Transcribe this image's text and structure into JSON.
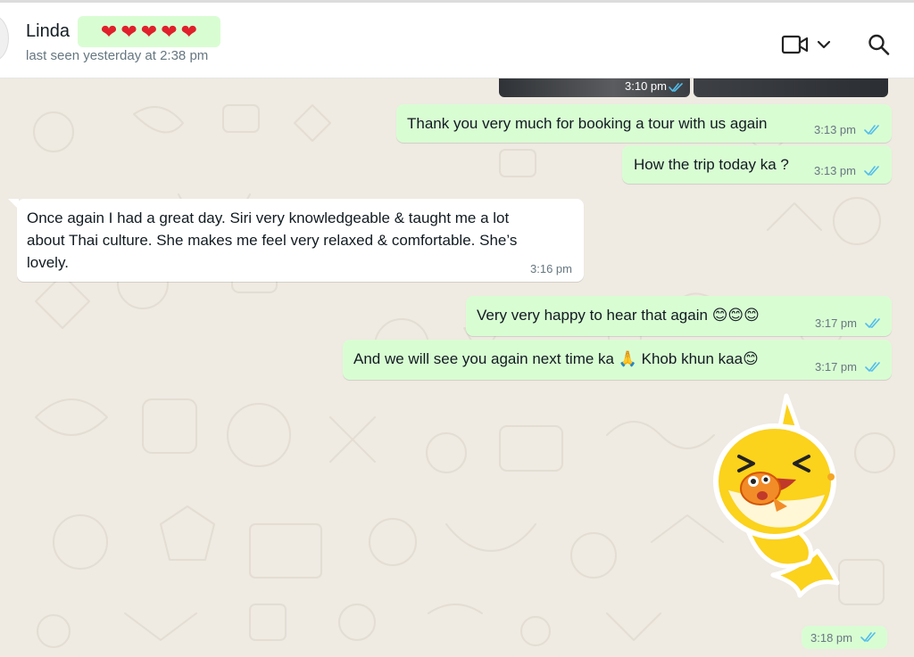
{
  "header": {
    "contact_name": "Linda",
    "hearts": [
      "❤",
      "❤",
      "❤",
      "❤",
      "❤"
    ],
    "status": "last seen yesterday at 2:38 pm",
    "icons": [
      "video-call-icon",
      "chevron-down-icon",
      "search-icon"
    ]
  },
  "messages": {
    "image_time": "3:10 pm",
    "m1": {
      "text": "Thank you very much for booking a tour with us again",
      "time": "3:13 pm"
    },
    "m2": {
      "text": "How the trip today ka ?",
      "time": "3:13 pm"
    },
    "m3": {
      "line1": "Once again I had a great day. Siri very knowledgeable & taught me a lot",
      "line2": "about Thai culture. She makes me feel very relaxed & comfortable. She’s",
      "line3": "lovely.",
      "time": "3:16 pm"
    },
    "m4": {
      "text": "Very very happy to hear that again",
      "emoji": "😊😊😊",
      "time": "3:17 pm"
    },
    "m5": {
      "text_a": "And we will see you again next time ka",
      "emoji_a": "🙏",
      "text_b": "Khob khun kaa",
      "emoji_b": "😊",
      "time": "3:17 pm"
    },
    "sticker_time": "3:18 pm"
  },
  "colors": {
    "outgoing_bubble": "#d9fdd3",
    "incoming_bubble": "#ffffff",
    "chat_background": "#efeae2",
    "read_tick": "#53bdeb",
    "heart": "#e0202b"
  }
}
